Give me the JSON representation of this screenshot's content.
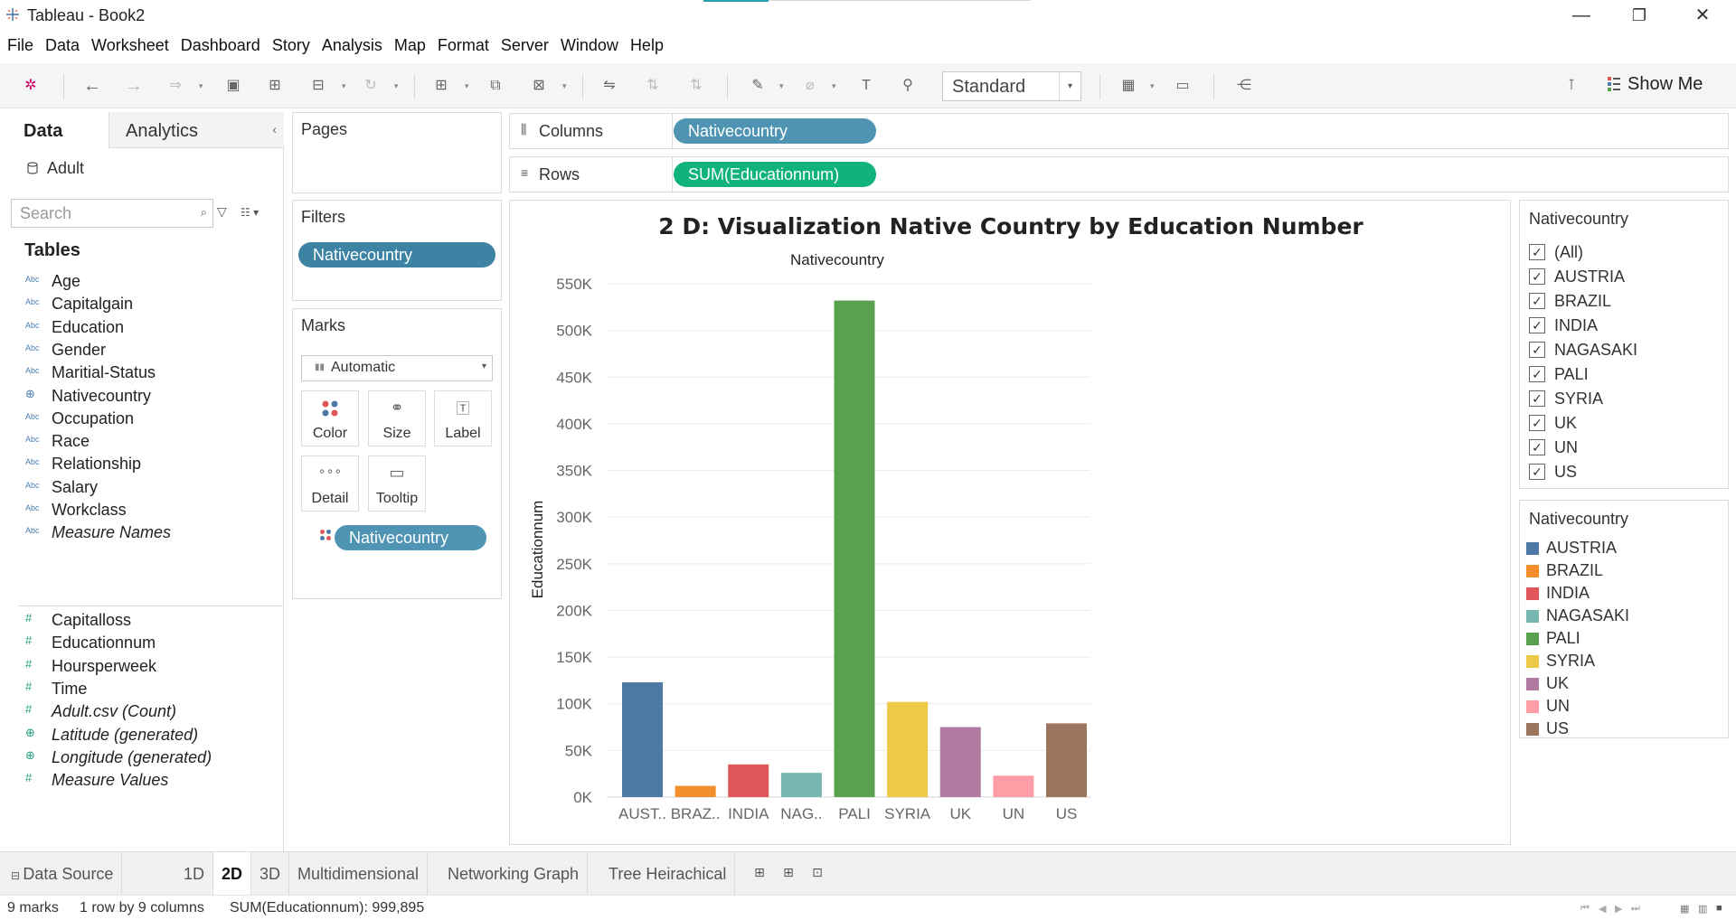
{
  "window": {
    "title": "Tableau - Book2",
    "minimize": "—",
    "restore": "❐",
    "close": "✕"
  },
  "menu": [
    "File",
    "Data",
    "Worksheet",
    "Dashboard",
    "Story",
    "Analysis",
    "Map",
    "Format",
    "Server",
    "Window",
    "Help"
  ],
  "toolbar": {
    "fit_select": "Standard",
    "show_me_label": "Show Me"
  },
  "data_pane": {
    "tab_data": "Data",
    "tab_analytics": "Analytics",
    "collapse": "‹",
    "datasource": "Adult",
    "search_placeholder": "Search",
    "tables_heading": "Tables",
    "dimensions": [
      {
        "type": "Abc",
        "name": "Age"
      },
      {
        "type": "Abc",
        "name": "Capitalgain"
      },
      {
        "type": "Abc",
        "name": "Education"
      },
      {
        "type": "Abc",
        "name": "Gender"
      },
      {
        "type": "Abc",
        "name": "Maritial-Status"
      },
      {
        "type": "⊕",
        "name": "Nativecountry"
      },
      {
        "type": "Abc",
        "name": "Occupation"
      },
      {
        "type": "Abc",
        "name": "Race"
      },
      {
        "type": "Abc",
        "name": "Relationship"
      },
      {
        "type": "Abc",
        "name": "Salary"
      },
      {
        "type": "Abc",
        "name": "Workclass"
      },
      {
        "type": "Abc",
        "name": "Measure Names"
      }
    ],
    "measures": [
      {
        "type": "#",
        "name": "Capitalloss"
      },
      {
        "type": "#",
        "name": "Educationnum"
      },
      {
        "type": "#",
        "name": "Hoursperweek"
      },
      {
        "type": "#",
        "name": "Time"
      },
      {
        "type": "#",
        "name": "Adult.csv (Count)"
      },
      {
        "type": "⊕",
        "name": "Latitude (generated)"
      },
      {
        "type": "⊕",
        "name": "Longitude (generated)"
      },
      {
        "type": "#",
        "name": "Measure Values"
      }
    ]
  },
  "cards": {
    "pages": "Pages",
    "filters": "Filters",
    "filter_pill": "Nativecountry",
    "marks": "Marks",
    "mark_type": "Automatic",
    "mark_buttons": {
      "color": "Color",
      "size": "Size",
      "label": "Label",
      "detail": "Detail",
      "tooltip": "Tooltip"
    },
    "color_pill": "Nativecountry"
  },
  "shelves": {
    "columns_label": "Columns",
    "columns_pill": "Nativecountry",
    "rows_label": "Rows",
    "rows_pill": "SUM(Educationnum)"
  },
  "viz": {
    "title": "2 D: Visualization Native Country by Education Number",
    "header": "Nativecountry"
  },
  "chart_data": {
    "type": "bar",
    "title": "2 D: Visualization Native Country by Education Number",
    "xlabel": "Nativecountry",
    "ylabel": "Educationnum",
    "categories": [
      "AUST..",
      "BRAZ..",
      "INDIA",
      "NAG..",
      "PALI",
      "SYRIA",
      "UK",
      "UN",
      "US"
    ],
    "values": [
      123000,
      12000,
      35000,
      26000,
      532000,
      102000,
      75000,
      23000,
      79000
    ],
    "colors": [
      "#4e79a7",
      "#f28e2b",
      "#e15759",
      "#76b7b2",
      "#59a14f",
      "#edc948",
      "#b07aa1",
      "#ff9da7",
      "#9c755f"
    ],
    "yticks": [
      0,
      50000,
      100000,
      150000,
      200000,
      250000,
      300000,
      350000,
      400000,
      450000,
      500000,
      550000
    ],
    "ytick_labels": [
      "0K",
      "50K",
      "100K",
      "150K",
      "200K",
      "250K",
      "300K",
      "350K",
      "400K",
      "450K",
      "500K",
      "550K"
    ],
    "ylim": [
      0,
      550000
    ],
    "grid": true
  },
  "filter_card": {
    "title": "Nativecountry",
    "items": [
      "(All)",
      "AUSTRIA",
      "BRAZIL",
      "INDIA",
      "NAGASAKI",
      "PALI",
      "SYRIA",
      "UK",
      "UN",
      "US"
    ],
    "check": "✓"
  },
  "legend_card": {
    "title": "Nativecountry",
    "items": [
      {
        "label": "AUSTRIA",
        "color": "#4e79a7"
      },
      {
        "label": "BRAZIL",
        "color": "#f28e2b"
      },
      {
        "label": "INDIA",
        "color": "#e15759"
      },
      {
        "label": "NAGASAKI",
        "color": "#76b7b2"
      },
      {
        "label": "PALI",
        "color": "#59a14f"
      },
      {
        "label": "SYRIA",
        "color": "#edc948"
      },
      {
        "label": "UK",
        "color": "#b07aa1"
      },
      {
        "label": "UN",
        "color": "#ff9da7"
      },
      {
        "label": "US",
        "color": "#9c755f"
      }
    ]
  },
  "sheet_tabs": {
    "datasource": "Data Source",
    "tabs": [
      "1D",
      "2D",
      "3D",
      "Multidimensional",
      "Networking Graph",
      "Tree Heirachical"
    ],
    "active": "2D"
  },
  "status": {
    "marks": "9 marks",
    "dims": "1 row by 9 columns",
    "sum": "SUM(Educationnum): 999,895"
  }
}
